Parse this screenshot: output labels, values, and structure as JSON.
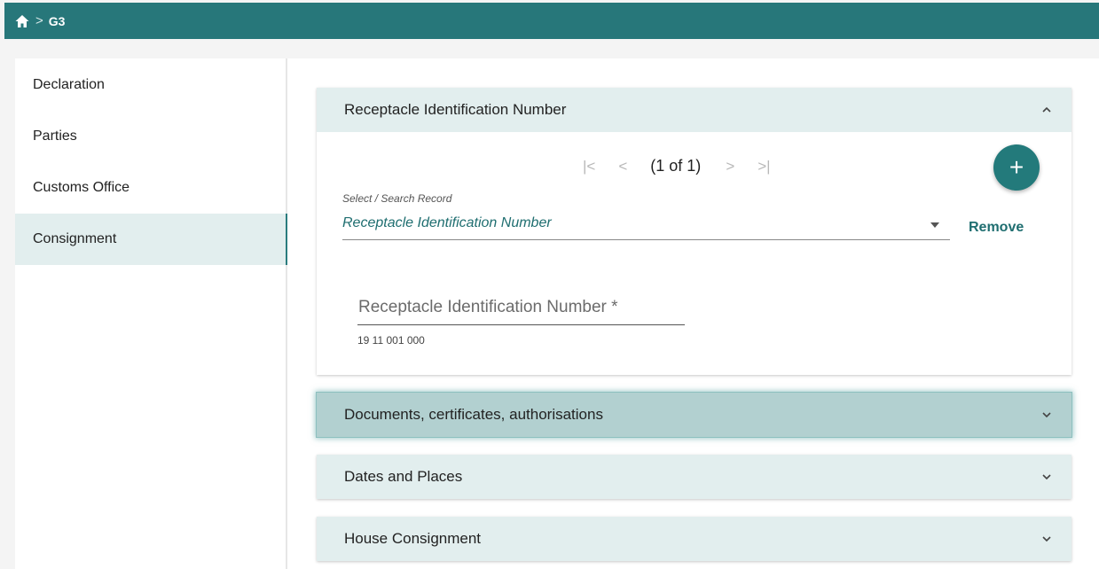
{
  "breadcrumb": {
    "current": "G3"
  },
  "sidebar": {
    "items": [
      {
        "label": "Declaration"
      },
      {
        "label": "Parties"
      },
      {
        "label": "Customs Office"
      },
      {
        "label": "Consignment"
      }
    ]
  },
  "sections": {
    "receptacle": {
      "title": "Receptacle Identification Number",
      "pager": {
        "first": "|<",
        "prev": "<",
        "count": "(1 of 1)",
        "next": ">",
        "last": ">|"
      },
      "add_label": "+",
      "select_label": "Select / Search Record",
      "select_value": "Receptacle Identification Number",
      "remove_label": "Remove",
      "field_placeholder": "Receptacle Identification Number *",
      "field_hint": "19 11 001 000"
    },
    "documents": {
      "title": "Documents, certificates, authorisations"
    },
    "dates": {
      "title": "Dates and Places"
    },
    "house": {
      "title": "House Consignment"
    }
  },
  "colors": {
    "topbar": "#27777a",
    "accent": "#237a7b",
    "panel_header": "#e2eeee",
    "highlight": "#b2d0d0"
  },
  "icons": {
    "home": "home-icon",
    "collapse": "chevron-up-icon",
    "expand": "chevron-down-icon"
  }
}
